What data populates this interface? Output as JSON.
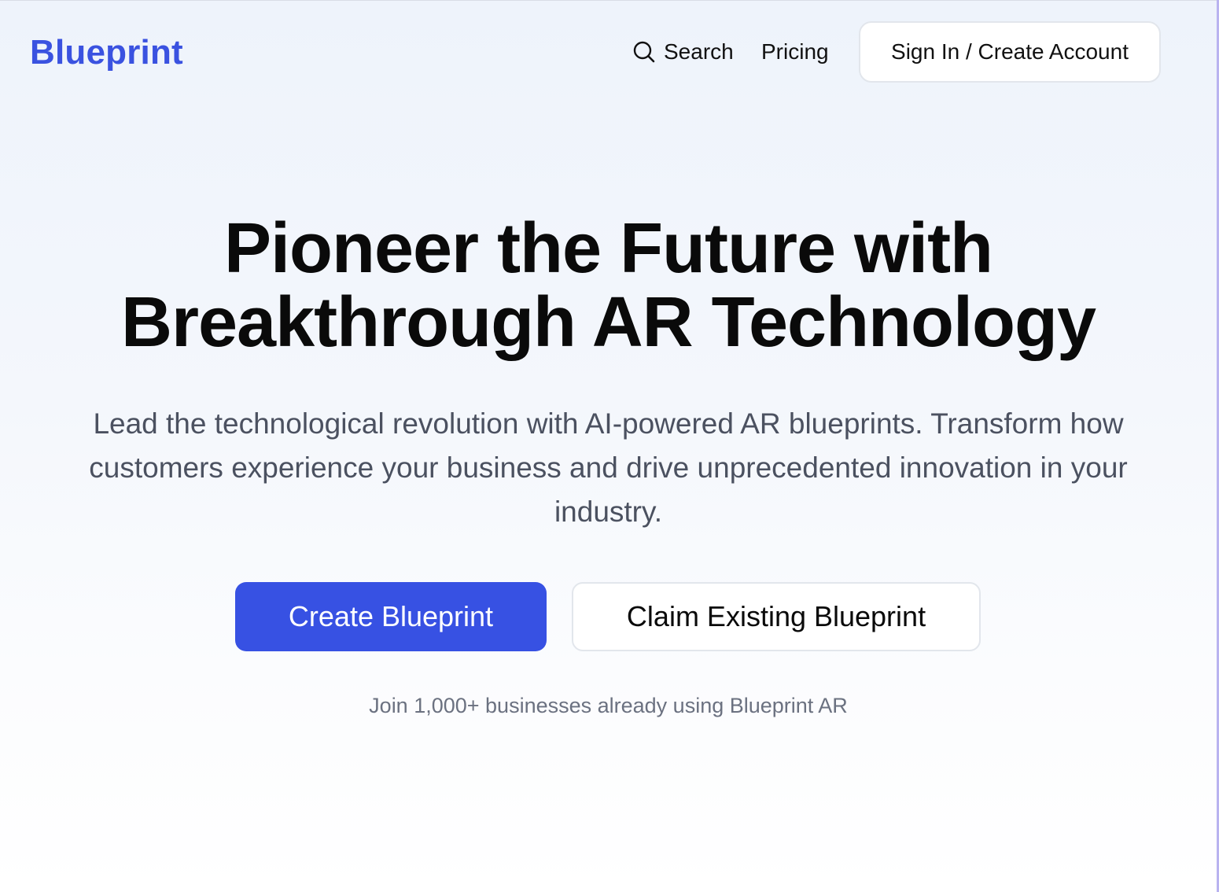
{
  "header": {
    "logo": "Blueprint",
    "nav": {
      "search_label": "Search",
      "search_icon": "search-icon",
      "pricing_label": "Pricing"
    },
    "signin_label": "Sign In / Create Account"
  },
  "hero": {
    "title_line1": "Pioneer the Future with",
    "title_line2": "Breakthrough AR Technology",
    "subtitle": "Lead the technological revolution with AI-powered AR blueprints. Transform how customers experience your business and drive unprecedented innovation in your industry.",
    "primary_cta": "Create Blueprint",
    "secondary_cta": "Claim Existing Blueprint",
    "social_proof": "Join 1,000+ businesses already using Blueprint AR"
  },
  "colors": {
    "brand": "#3a52e0",
    "primary_button": "#3751e3",
    "heading": "#0a0a0a",
    "muted_text": "#4b5160",
    "caption_text": "#6b7180"
  }
}
